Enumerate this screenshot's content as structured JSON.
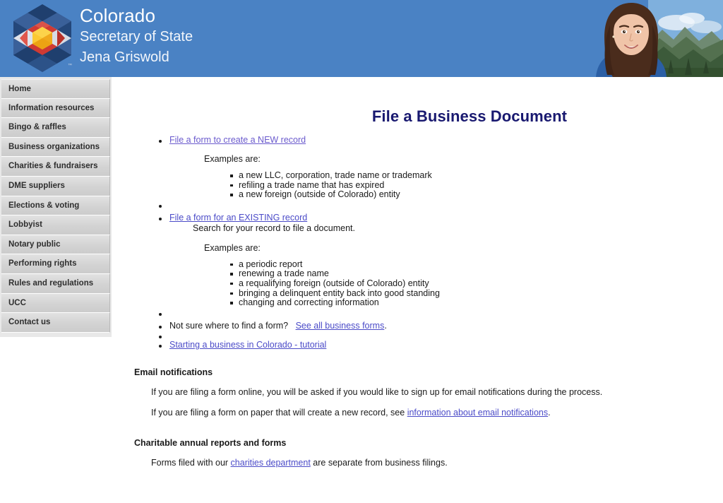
{
  "header": {
    "agency": "Colorado",
    "department": "Secretary of State",
    "official": "Jena Griswold",
    "trademark": "™",
    "brand_blue": "#4a82c4",
    "logo_name": "colorado-hexagon-logo",
    "photo_name": "jena-griswold-portrait"
  },
  "sidebar": {
    "items": [
      {
        "label": "Home"
      },
      {
        "label": "Information resources"
      },
      {
        "label": "Bingo & raffles"
      },
      {
        "label": "Business organizations"
      },
      {
        "label": "Charities & fundraisers"
      },
      {
        "label": "DME suppliers"
      },
      {
        "label": "Elections & voting"
      },
      {
        "label": "Lobbyist"
      },
      {
        "label": "Notary public"
      },
      {
        "label": "Performing rights"
      },
      {
        "label": "Rules and regulations"
      },
      {
        "label": "UCC"
      },
      {
        "label": "Contact us"
      }
    ]
  },
  "main": {
    "page_title": "File a Business Document",
    "new_record": {
      "link": "File a form to create a NEW record",
      "examples_label": "Examples are:",
      "examples": [
        "a new LLC, corporation, trade name or trademark",
        "refiling a trade name that has expired",
        "a new foreign (outside of Colorado) entity"
      ]
    },
    "existing_record": {
      "link": "File a form for an EXISTING record",
      "subtitle": "Search for your record to file a document.",
      "examples_label": "Examples are:",
      "examples": [
        "a periodic report",
        "renewing a trade name",
        "a requalifying foreign (outside of Colorado) entity",
        "bringing a delinquent entity back into good standing",
        "changing and correcting information"
      ]
    },
    "find_form": {
      "text_before": "Not sure where to find a form?",
      "link": "See all business forms",
      "text_after": "."
    },
    "tutorial": {
      "link": "Starting a business in Colorado - tutorial"
    },
    "email_notifications": {
      "heading": "Email notifications",
      "paragraph1": "If you are filing a form online, you will be asked if you would like to sign up for email notifications during the process.",
      "paragraph2_before": "If you are filing a form on paper that will create a new record, see",
      "paragraph2_link": "information about email notifications",
      "paragraph2_after": "."
    },
    "charitable": {
      "heading": "Charitable annual reports and forms",
      "text_before": "Forms filed with our",
      "link": "charities department",
      "text_after": "are separate from business filings."
    }
  },
  "colors": {
    "header_blue": "#4a82c4",
    "title_navy": "#191970",
    "link_purple": "#6a5acd",
    "sidebar_gray": "#d3d3d3"
  }
}
